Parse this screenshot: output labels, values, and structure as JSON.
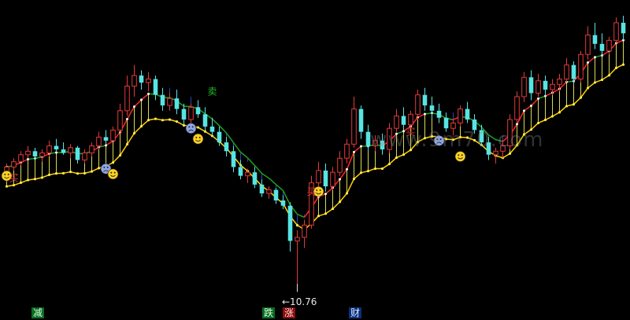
{
  "watermark": "www.9m70.com",
  "chart_data": {
    "type": "candlestick",
    "ylim": [
      10,
      26
    ],
    "colors": {
      "up": "#e23a3a",
      "down": "#59e4e4",
      "upper_band": "#20a020",
      "lower_band": "#ffd400",
      "bull_fill": "#ffff66",
      "bear_fill": "#2e4fd6",
      "accel": "#ff2828"
    },
    "candles": [
      [
        17.1,
        17.6,
        16.9,
        17.4
      ],
      [
        17.4,
        17.9,
        17.2,
        17.7
      ],
      [
        17.7,
        18.3,
        17.5,
        18.1
      ],
      [
        18.1,
        18.6,
        17.9,
        18.3
      ],
      [
        18.3,
        18.5,
        17.8,
        18.0
      ],
      [
        18.0,
        18.4,
        17.7,
        18.2
      ],
      [
        18.2,
        18.9,
        18.0,
        18.6
      ],
      [
        18.6,
        19.0,
        18.3,
        18.4
      ],
      [
        18.4,
        18.8,
        18.1,
        18.2
      ],
      [
        18.2,
        18.7,
        17.9,
        18.5
      ],
      [
        18.5,
        18.6,
        17.6,
        17.8
      ],
      [
        17.8,
        18.4,
        17.6,
        18.2
      ],
      [
        18.2,
        18.8,
        18.0,
        18.6
      ],
      [
        18.6,
        19.4,
        18.4,
        19.1
      ],
      [
        19.1,
        19.5,
        18.7,
        18.9
      ],
      [
        18.9,
        19.7,
        18.8,
        19.5
      ],
      [
        19.5,
        21.0,
        19.3,
        20.6
      ],
      [
        20.6,
        22.6,
        20.3,
        22.0
      ],
      [
        22.0,
        23.2,
        21.4,
        22.6
      ],
      [
        22.6,
        22.9,
        21.8,
        22.2
      ],
      [
        22.2,
        22.8,
        21.7,
        22.4
      ],
      [
        22.4,
        22.6,
        21.2,
        21.5
      ],
      [
        21.5,
        21.9,
        20.6,
        20.9
      ],
      [
        20.9,
        21.6,
        20.6,
        21.3
      ],
      [
        21.3,
        21.8,
        20.4,
        20.7
      ],
      [
        20.7,
        21.0,
        19.8,
        20.1
      ],
      [
        20.1,
        21.0,
        19.9,
        20.8
      ],
      [
        20.8,
        21.2,
        20.2,
        20.4
      ],
      [
        20.4,
        20.8,
        19.5,
        19.7
      ],
      [
        19.7,
        20.2,
        19.1,
        19.4
      ],
      [
        19.4,
        19.7,
        18.6,
        18.8
      ],
      [
        18.8,
        19.1,
        18.0,
        18.3
      ],
      [
        18.3,
        18.6,
        17.1,
        17.4
      ],
      [
        17.4,
        17.8,
        16.7,
        16.9
      ],
      [
        16.9,
        17.3,
        16.5,
        17.1
      ],
      [
        17.1,
        17.4,
        16.2,
        16.4
      ],
      [
        16.4,
        16.7,
        15.7,
        15.9
      ],
      [
        15.9,
        16.3,
        15.6,
        16.1
      ],
      [
        16.1,
        16.2,
        15.3,
        15.5
      ],
      [
        15.5,
        15.8,
        15.0,
        15.2
      ],
      [
        15.2,
        15.4,
        12.6,
        13.2
      ],
      [
        13.2,
        13.8,
        10.76,
        13.4
      ],
      [
        13.4,
        14.4,
        12.8,
        14.1
      ],
      [
        14.1,
        16.9,
        13.9,
        16.5
      ],
      [
        16.5,
        17.7,
        16.2,
        17.2
      ],
      [
        17.2,
        17.6,
        16.0,
        16.3
      ],
      [
        16.3,
        17.4,
        16.1,
        17.1
      ],
      [
        17.1,
        18.3,
        16.9,
        17.9
      ],
      [
        17.9,
        19.0,
        17.6,
        18.7
      ],
      [
        18.7,
        21.4,
        18.5,
        20.7
      ],
      [
        20.7,
        20.9,
        19.0,
        19.4
      ],
      [
        19.4,
        19.8,
        18.3,
        18.6
      ],
      [
        18.6,
        19.2,
        18.3,
        18.9
      ],
      [
        18.9,
        19.3,
        18.1,
        18.4
      ],
      [
        18.4,
        19.9,
        18.2,
        19.6
      ],
      [
        19.6,
        20.7,
        19.4,
        20.3
      ],
      [
        20.3,
        20.8,
        19.5,
        19.8
      ],
      [
        19.8,
        20.6,
        19.6,
        20.4
      ],
      [
        20.4,
        21.8,
        20.1,
        21.5
      ],
      [
        21.5,
        21.9,
        20.6,
        20.9
      ],
      [
        20.9,
        21.4,
        20.2,
        20.6
      ],
      [
        20.6,
        21.0,
        19.9,
        20.2
      ],
      [
        20.2,
        20.5,
        19.4,
        19.6
      ],
      [
        19.6,
        20.1,
        19.2,
        19.9
      ],
      [
        19.9,
        20.9,
        19.7,
        20.7
      ],
      [
        20.7,
        21.1,
        19.9,
        20.1
      ],
      [
        20.1,
        20.4,
        19.3,
        19.5
      ],
      [
        19.5,
        19.8,
        18.6,
        18.8
      ],
      [
        18.8,
        19.1,
        17.8,
        18.1
      ],
      [
        18.1,
        18.5,
        17.6,
        18.3
      ],
      [
        18.3,
        18.9,
        17.9,
        18.6
      ],
      [
        18.6,
        20.4,
        18.4,
        20.1
      ],
      [
        20.1,
        21.7,
        19.9,
        21.4
      ],
      [
        21.4,
        22.8,
        21.1,
        22.5
      ],
      [
        22.5,
        22.9,
        21.2,
        21.6
      ],
      [
        21.6,
        22.7,
        21.4,
        22.3
      ],
      [
        22.3,
        22.6,
        21.4,
        21.8
      ],
      [
        21.8,
        22.4,
        21.5,
        22.1
      ],
      [
        22.1,
        22.7,
        21.7,
        22.4
      ],
      [
        22.4,
        23.6,
        22.2,
        23.2
      ],
      [
        23.2,
        23.4,
        22.1,
        22.4
      ],
      [
        22.4,
        24.0,
        22.2,
        23.8
      ],
      [
        23.8,
        25.4,
        23.5,
        24.9
      ],
      [
        24.9,
        25.6,
        24.1,
        24.4
      ],
      [
        24.4,
        25.0,
        23.7,
        24.0
      ],
      [
        24.0,
        24.8,
        23.8,
        24.6
      ],
      [
        24.6,
        25.9,
        24.4,
        25.6
      ],
      [
        25.6,
        26.0,
        24.6,
        25.0
      ]
    ],
    "annotations": {
      "low_value": "←10.76",
      "trade_markers": [
        {
          "bar": 1,
          "text": "买",
          "price": 16.6,
          "color": "#e23a3a"
        },
        {
          "bar": 57,
          "text": "买",
          "price": 19.2,
          "color": "#e23a3a"
        },
        {
          "bar": 29,
          "text": "卖",
          "price": 21.5,
          "color": "#20c020"
        },
        {
          "bar": 43,
          "text": "买",
          "price": 15.8,
          "color": "#e23a3a"
        }
      ],
      "smileys": [
        {
          "bar": 0,
          "price": 16.9,
          "mood": "happy"
        },
        {
          "bar": 14,
          "price": 17.3,
          "mood": "sad"
        },
        {
          "bar": 15,
          "price": 17.0,
          "mood": "happy"
        },
        {
          "bar": 26,
          "price": 19.6,
          "mood": "sad"
        },
        {
          "bar": 27,
          "price": 19.0,
          "mood": "happy"
        },
        {
          "bar": 44,
          "price": 16.0,
          "mood": "happy"
        },
        {
          "bar": 61,
          "price": 18.9,
          "mood": "sad"
        },
        {
          "bar": 64,
          "price": 18.0,
          "mood": "happy"
        }
      ]
    }
  },
  "bottom_labels": [
    {
      "text": "减",
      "x": 40,
      "style": "lbl-green"
    },
    {
      "text": "跌",
      "x": 333,
      "style": "lbl-green"
    },
    {
      "text": "涨",
      "x": 359,
      "style": "lbl-red"
    },
    {
      "text": "财",
      "x": 443,
      "style": "lbl-blue"
    }
  ]
}
